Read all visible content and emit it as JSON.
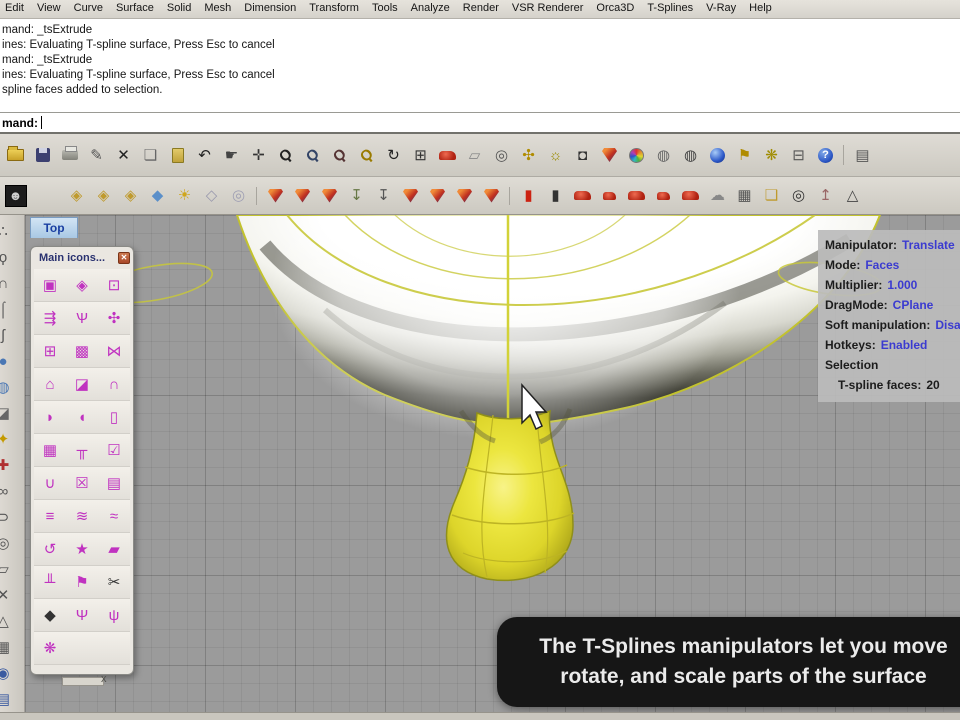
{
  "menu": {
    "items": [
      "Edit",
      "View",
      "Curve",
      "Surface",
      "Solid",
      "Mesh",
      "Dimension",
      "Transform",
      "Tools",
      "Analyze",
      "Render",
      "VSR Renderer",
      "Orca3D",
      "T-Splines",
      "V-Ray",
      "Help"
    ]
  },
  "command": {
    "history": [
      "mand: _tsExtrude",
      "ines: Evaluating T-spline surface, Press Esc to cancel",
      "mand: _tsExtrude",
      "ines: Evaluating T-spline surface, Press Esc to cancel",
      "spline faces added to selection."
    ],
    "prompt": "mand:"
  },
  "toolbar_main": {
    "icons": [
      {
        "n": "open-file-icon",
        "t": "folder"
      },
      {
        "n": "save-icon",
        "t": "floppy"
      },
      {
        "n": "print-icon",
        "t": "printer"
      },
      {
        "n": "edit-page-icon",
        "g": "✎",
        "c": "#555555"
      },
      {
        "n": "delete-icon",
        "g": "✕",
        "c": "#222222"
      },
      {
        "n": "copy-icon",
        "g": "❏",
        "c": "#666666"
      },
      {
        "n": "paste-icon",
        "t": "paste"
      },
      {
        "n": "undo-icon",
        "g": "↶",
        "c": "#222222"
      },
      {
        "n": "pan-hand-icon",
        "g": "☛",
        "c": "#444444"
      },
      {
        "n": "move-icon",
        "g": "✛",
        "c": "#333333"
      },
      {
        "n": "zoom-icon",
        "g": "Ϙ",
        "c": "#222222",
        "cls": "mag"
      },
      {
        "n": "zoom-window-icon",
        "g": "Ϙ",
        "c": "#334466",
        "cls": "mag"
      },
      {
        "n": "zoom-extents-icon",
        "g": "Ϙ",
        "c": "#553333",
        "cls": "mag"
      },
      {
        "n": "zoom-selected-icon",
        "g": "Ϙ",
        "c": "#9a7b00",
        "cls": "mag"
      },
      {
        "n": "rotate-view-icon",
        "g": "↻",
        "c": "#222222"
      },
      {
        "n": "viewport-layout-icon",
        "g": "⊞",
        "c": "#333333"
      },
      {
        "n": "car-display-icon",
        "t": "car"
      },
      {
        "n": "stamp-icon",
        "g": "▱",
        "c": "#888888"
      },
      {
        "n": "orient-icon",
        "g": "◎",
        "c": "#555555"
      },
      {
        "n": "molecule-icon",
        "g": "✣",
        "c": "#b08c00"
      },
      {
        "n": "lightbulb-icon",
        "g": "☼",
        "c": "#9a8c00"
      },
      {
        "n": "lock-icon",
        "g": "◘",
        "c": "#333333"
      },
      {
        "n": "shield-icon",
        "t": "shield"
      },
      {
        "n": "color-wheel-icon",
        "t": "wheel"
      },
      {
        "n": "wire-sphere-icon",
        "g": "◍",
        "c": "#666666"
      },
      {
        "n": "wire-sphere-selected-icon",
        "g": "◍",
        "c": "#444444"
      },
      {
        "n": "render-sphere-icon",
        "t": "sphere"
      },
      {
        "n": "flag-icon",
        "g": "⚑",
        "c": "#b08c00"
      },
      {
        "n": "gear-icon",
        "g": "❋",
        "c": "#a08c00"
      },
      {
        "n": "layer-icon",
        "g": "⊟",
        "c": "#555555"
      },
      {
        "n": "help-icon",
        "t": "help",
        "g": "?"
      },
      {
        "n": "notebook-partial-icon",
        "g": "▤",
        "c": "#555555",
        "sep": true
      }
    ]
  },
  "toolbar_secondary": {
    "icons": [
      {
        "n": "panel-toggle-icon",
        "t": "dark",
        "g": "☻"
      },
      {
        "n": "toolbar-spacer",
        "spacer": true
      },
      {
        "n": "ts-badge-1-icon",
        "g": "◈",
        "c": "#bf9a2e"
      },
      {
        "n": "ts-badge-2-icon",
        "g": "◈",
        "c": "#bf9a2e"
      },
      {
        "n": "ts-badge-3-icon",
        "g": "◈",
        "c": "#bf9a2e"
      },
      {
        "n": "blue-cube-icon",
        "g": "◆",
        "c": "#5b8fc9"
      },
      {
        "n": "sun-icon",
        "g": "☀",
        "c": "#cfa61c"
      },
      {
        "n": "diamond-outline-icon",
        "g": "◇",
        "c": "#9a9aae"
      },
      {
        "n": "circle-badge-icon",
        "g": "◎",
        "c": "#a0a0b4"
      },
      {
        "n": "tsplines-shield-1-icon",
        "t": "shield",
        "sep": true
      },
      {
        "n": "tsplines-shield-2-icon",
        "t": "shield"
      },
      {
        "n": "tsplines-shield-3-icon",
        "t": "shield"
      },
      {
        "n": "pin-bulb-icon",
        "g": "↧",
        "c": "#667744"
      },
      {
        "n": "pin-dark-icon",
        "g": "↧",
        "c": "#555555"
      },
      {
        "n": "bulb-shield-icon",
        "t": "shield"
      },
      {
        "n": "shield-cup-icon",
        "t": "shield"
      },
      {
        "n": "shield-pen-icon",
        "t": "shield"
      },
      {
        "n": "shield-page-icon",
        "t": "shield"
      },
      {
        "n": "battery-icon",
        "g": "▮",
        "c": "#cc2211",
        "sep": true
      },
      {
        "n": "capsule-icon",
        "g": "▮",
        "c": "#333333"
      },
      {
        "n": "car-1-icon",
        "t": "car"
      },
      {
        "n": "car-2-icon",
        "t": "car-sm"
      },
      {
        "n": "car-3-icon",
        "t": "car"
      },
      {
        "n": "car-4-icon",
        "t": "car-sm"
      },
      {
        "n": "car-ball-icon",
        "t": "car"
      },
      {
        "n": "car-cloud-icon",
        "g": "☁",
        "c": "#888888"
      },
      {
        "n": "train-save-icon",
        "g": "▦",
        "c": "#555555"
      },
      {
        "n": "folder-pen-icon",
        "g": "❏",
        "c": "#bf9a2e"
      },
      {
        "n": "target-icon",
        "g": "◎",
        "c": "#333333"
      },
      {
        "n": "antenna-icon",
        "g": "↥",
        "c": "#996666"
      },
      {
        "n": "cone-wire-icon",
        "g": "△",
        "c": "#444444"
      }
    ]
  },
  "side_toolbar": {
    "icons": [
      {
        "n": "point-tool-icon",
        "g": "∴",
        "c": "#555555"
      },
      {
        "n": "curve-tool-icon",
        "g": "ϙ",
        "c": "#555555"
      },
      {
        "n": "arc-tool-icon",
        "g": "∩",
        "c": "#555555"
      },
      {
        "n": "polyline-tool-icon",
        "g": "⌠",
        "c": "#555555"
      },
      {
        "n": "freeform-tool-icon",
        "g": "ʃ",
        "c": "#555555"
      },
      {
        "n": "sphere-tool-icon",
        "g": "●",
        "c": "#4a77b4"
      },
      {
        "n": "surface-tool-icon",
        "g": "◍",
        "c": "#4a77b4"
      },
      {
        "n": "plane-tool-icon",
        "g": "◪",
        "c": "#666666"
      },
      {
        "n": "star-tool-icon",
        "g": "✦",
        "c": "#c49a00"
      },
      {
        "n": "cross-tool-icon",
        "g": "✚",
        "c": "#b03030"
      },
      {
        "n": "chain-tool-icon",
        "g": "∞",
        "c": "#555555"
      },
      {
        "n": "scale-tool-icon",
        "g": "⊃",
        "c": "#555555"
      },
      {
        "n": "circle-tool-icon",
        "g": "◎",
        "c": "#555555"
      },
      {
        "n": "cylinder-tool-icon",
        "g": "▱",
        "c": "#555555"
      },
      {
        "n": "delete-tool-icon",
        "g": "✕",
        "c": "#555555"
      },
      {
        "n": "triangle-tool-icon",
        "g": "△",
        "c": "#555555"
      },
      {
        "n": "mesh-tool-icon",
        "g": "▦",
        "c": "#555555"
      },
      {
        "n": "dot-tool-icon",
        "g": "◉",
        "c": "#3a5aa0"
      },
      {
        "n": "book-tool-icon",
        "g": "▤",
        "c": "#3a5aa0"
      }
    ]
  },
  "viewport": {
    "tab": "Top"
  },
  "palette": {
    "title": "Main icons...",
    "close_glyph": "✕",
    "footer_x": "x",
    "icons": [
      {
        "n": "ts-extrude-icon",
        "g": "▣"
      },
      {
        "n": "ts-sphere-cube-icon",
        "g": "◈"
      },
      {
        "n": "ts-framed-cube-icon",
        "g": "⊡"
      },
      {
        "n": "ts-arrows-icon",
        "g": "⇶"
      },
      {
        "n": "ts-hand-icon",
        "g": "Ѱ"
      },
      {
        "n": "ts-axis-icon",
        "g": "✣"
      },
      {
        "n": "ts-vertex-cube-icon",
        "g": "⊞"
      },
      {
        "n": "ts-pattern-lock-icon",
        "g": "▩"
      },
      {
        "n": "ts-linked-cubes-icon",
        "g": "⋈"
      },
      {
        "n": "ts-dome-icon",
        "g": "⌂"
      },
      {
        "n": "ts-bent-plane-icon",
        "g": "◪"
      },
      {
        "n": "ts-magnet-icon",
        "g": "∩"
      },
      {
        "n": "ts-shell-icon",
        "g": "◗"
      },
      {
        "n": "ts-wing-icon",
        "g": "◖"
      },
      {
        "n": "ts-open-box-icon",
        "g": "▯"
      },
      {
        "n": "ts-grid-box-icon",
        "g": "▦"
      },
      {
        "n": "ts-bench-icon",
        "g": "╥"
      },
      {
        "n": "ts-check-grid-icon",
        "g": "☑"
      },
      {
        "n": "ts-merge-icon",
        "g": "∪"
      },
      {
        "n": "ts-delete-grid-icon",
        "g": "☒"
      },
      {
        "n": "ts-grid-icon",
        "g": "▤"
      },
      {
        "n": "ts-stack-icon",
        "g": "≡"
      },
      {
        "n": "ts-flame-grid-1-icon",
        "g": "≋"
      },
      {
        "n": "ts-flame-grid-2-icon",
        "g": "≈"
      },
      {
        "n": "ts-swirl-icon",
        "g": "↺"
      },
      {
        "n": "ts-star-cycle-icon",
        "g": "★"
      },
      {
        "n": "ts-crumple-icon",
        "g": "▰"
      },
      {
        "n": "ts-comb-icon",
        "g": "╨"
      },
      {
        "n": "ts-flag-icon",
        "g": "⚑"
      },
      {
        "n": "ts-scissors-icon",
        "g": "✂",
        "c": "#333333"
      },
      {
        "n": "ts-rock-icon",
        "g": "◆",
        "c": "#333333"
      },
      {
        "n": "ts-branch-icon",
        "g": "Ψ"
      },
      {
        "n": "ts-trident-icon",
        "g": "ψ"
      },
      {
        "n": "ts-gear-icon",
        "g": "❋"
      },
      {
        "n": "palette-empty-cell",
        "g": "",
        "static": true
      },
      {
        "n": "palette-empty-cell",
        "g": "",
        "static": true
      }
    ]
  },
  "info_panel": {
    "rows": [
      {
        "label": "Manipulator:",
        "value": "Translate"
      },
      {
        "label": "Mode:",
        "value": "Faces"
      },
      {
        "label": "Multiplier:",
        "value": "1.000"
      },
      {
        "label": "DragMode:",
        "value": "CPlane"
      },
      {
        "label": "Soft manipulation:",
        "value": "Disabled"
      },
      {
        "label": "Hotkeys:",
        "value": "Enabled"
      },
      {
        "label": "Selection",
        "value": ""
      },
      {
        "label": "T-spline faces:",
        "value": "20",
        "indent": true,
        "value_dark": true
      }
    ]
  },
  "caption": {
    "line1": "The T-Splines manipulators let you move",
    "line2": "rotate, and scale parts of the surface"
  },
  "colors": {
    "viewport_bg": "#9b9b9b",
    "toolbar_bg": "#d6d2ca",
    "caption_bg": "#161616",
    "hud_value_blue": "#3b3bd0",
    "selection_yellow": "#e0da35",
    "palette_icon_magenta": "#c032c0"
  }
}
